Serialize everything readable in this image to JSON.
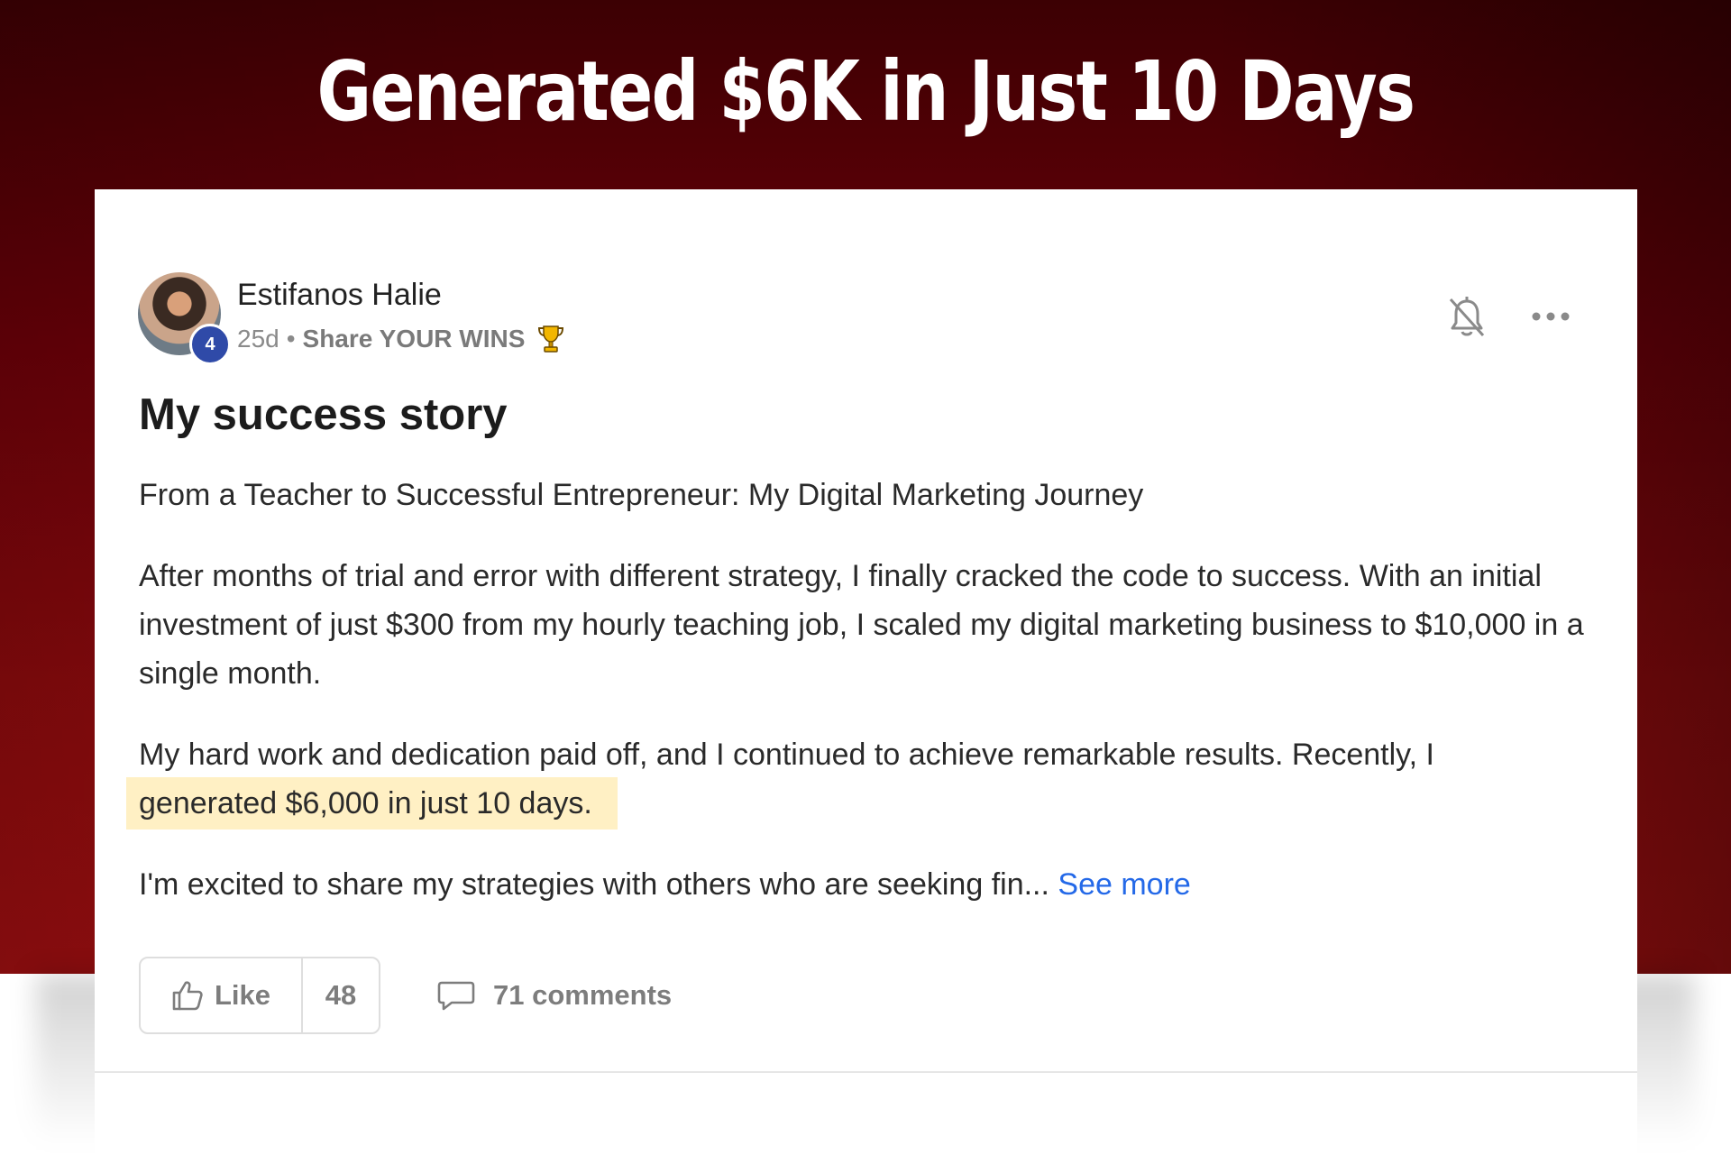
{
  "banner": {
    "headline": "Generated $6K in Just 10 Days",
    "colors": {
      "top": "#3c0003",
      "bottom": "#9a0f10",
      "text": "#ffffff"
    }
  },
  "post": {
    "author": {
      "name": "Estifanos Halie",
      "level": "4",
      "avatar_icon": "user-photo-avatar"
    },
    "meta": {
      "age": "25d",
      "separator": "•",
      "category": "Share YOUR WINS",
      "category_icon": "trophy-icon"
    },
    "actions": {
      "bell_icon": "bell-off-icon",
      "more_icon": "more-horizontal-icon"
    },
    "title": "My success story",
    "paragraphs": [
      "From a Teacher to Successful Entrepreneur: My Digital Marketing Journey",
      "After months of trial and error with different strategy, I finally cracked the code to success. With an initial investment of just $300 from my hourly teaching job, I scaled my digital marketing business to $10,000 in a single month."
    ],
    "paragraph3": {
      "text": "My hard work and dedication paid off, and I continued to achieve remarkable results. Recently, I ",
      "highlight": "generated $6,000 in just 10 days.",
      "highlight_color": "#fff0c4"
    },
    "paragraph4": {
      "text": "I'm excited to share my strategies with others who are seeking fin... ",
      "see_more": "See more",
      "link_color": "#2469e8"
    },
    "footer": {
      "like_label": "Like",
      "like_count": "48",
      "comments_label": "71 comments",
      "like_icon": "thumbs-up-icon",
      "comment_icon": "comment-bubble-icon"
    }
  }
}
